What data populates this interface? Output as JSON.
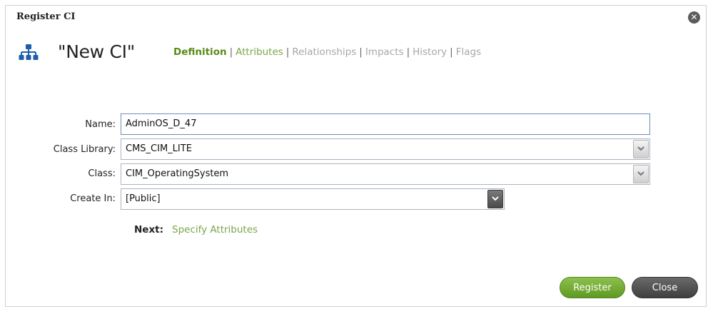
{
  "dialog": {
    "title": "Register CI",
    "close_icon": "close-icon"
  },
  "header": {
    "icon": "hierarchy-icon",
    "ci_name": "\"New CI\""
  },
  "tabs": [
    {
      "label": "Definition",
      "state": "active"
    },
    {
      "label": "Attributes",
      "state": "enabled"
    },
    {
      "label": "Relationships",
      "state": "disabled"
    },
    {
      "label": "Impacts",
      "state": "disabled"
    },
    {
      "label": "History",
      "state": "disabled"
    },
    {
      "label": "Flags",
      "state": "disabled"
    }
  ],
  "tab_separator": "|",
  "form": {
    "name": {
      "label": "Name:",
      "value": "AdminOS_D_47"
    },
    "class_library": {
      "label": "Class Library:",
      "value": "CMS_CIM_LITE"
    },
    "class": {
      "label": "Class:",
      "value": "CIM_OperatingSystem"
    },
    "create_in": {
      "label": "Create In:",
      "value": "[Public]"
    }
  },
  "next": {
    "label": "Next:",
    "link": "Specify Attributes"
  },
  "buttons": {
    "register": "Register",
    "close": "Close"
  },
  "colors": {
    "accent_green": "#79a64a",
    "active_tab": "#5a8a17",
    "register_button": "#6fa92f",
    "close_button": "#555555"
  }
}
